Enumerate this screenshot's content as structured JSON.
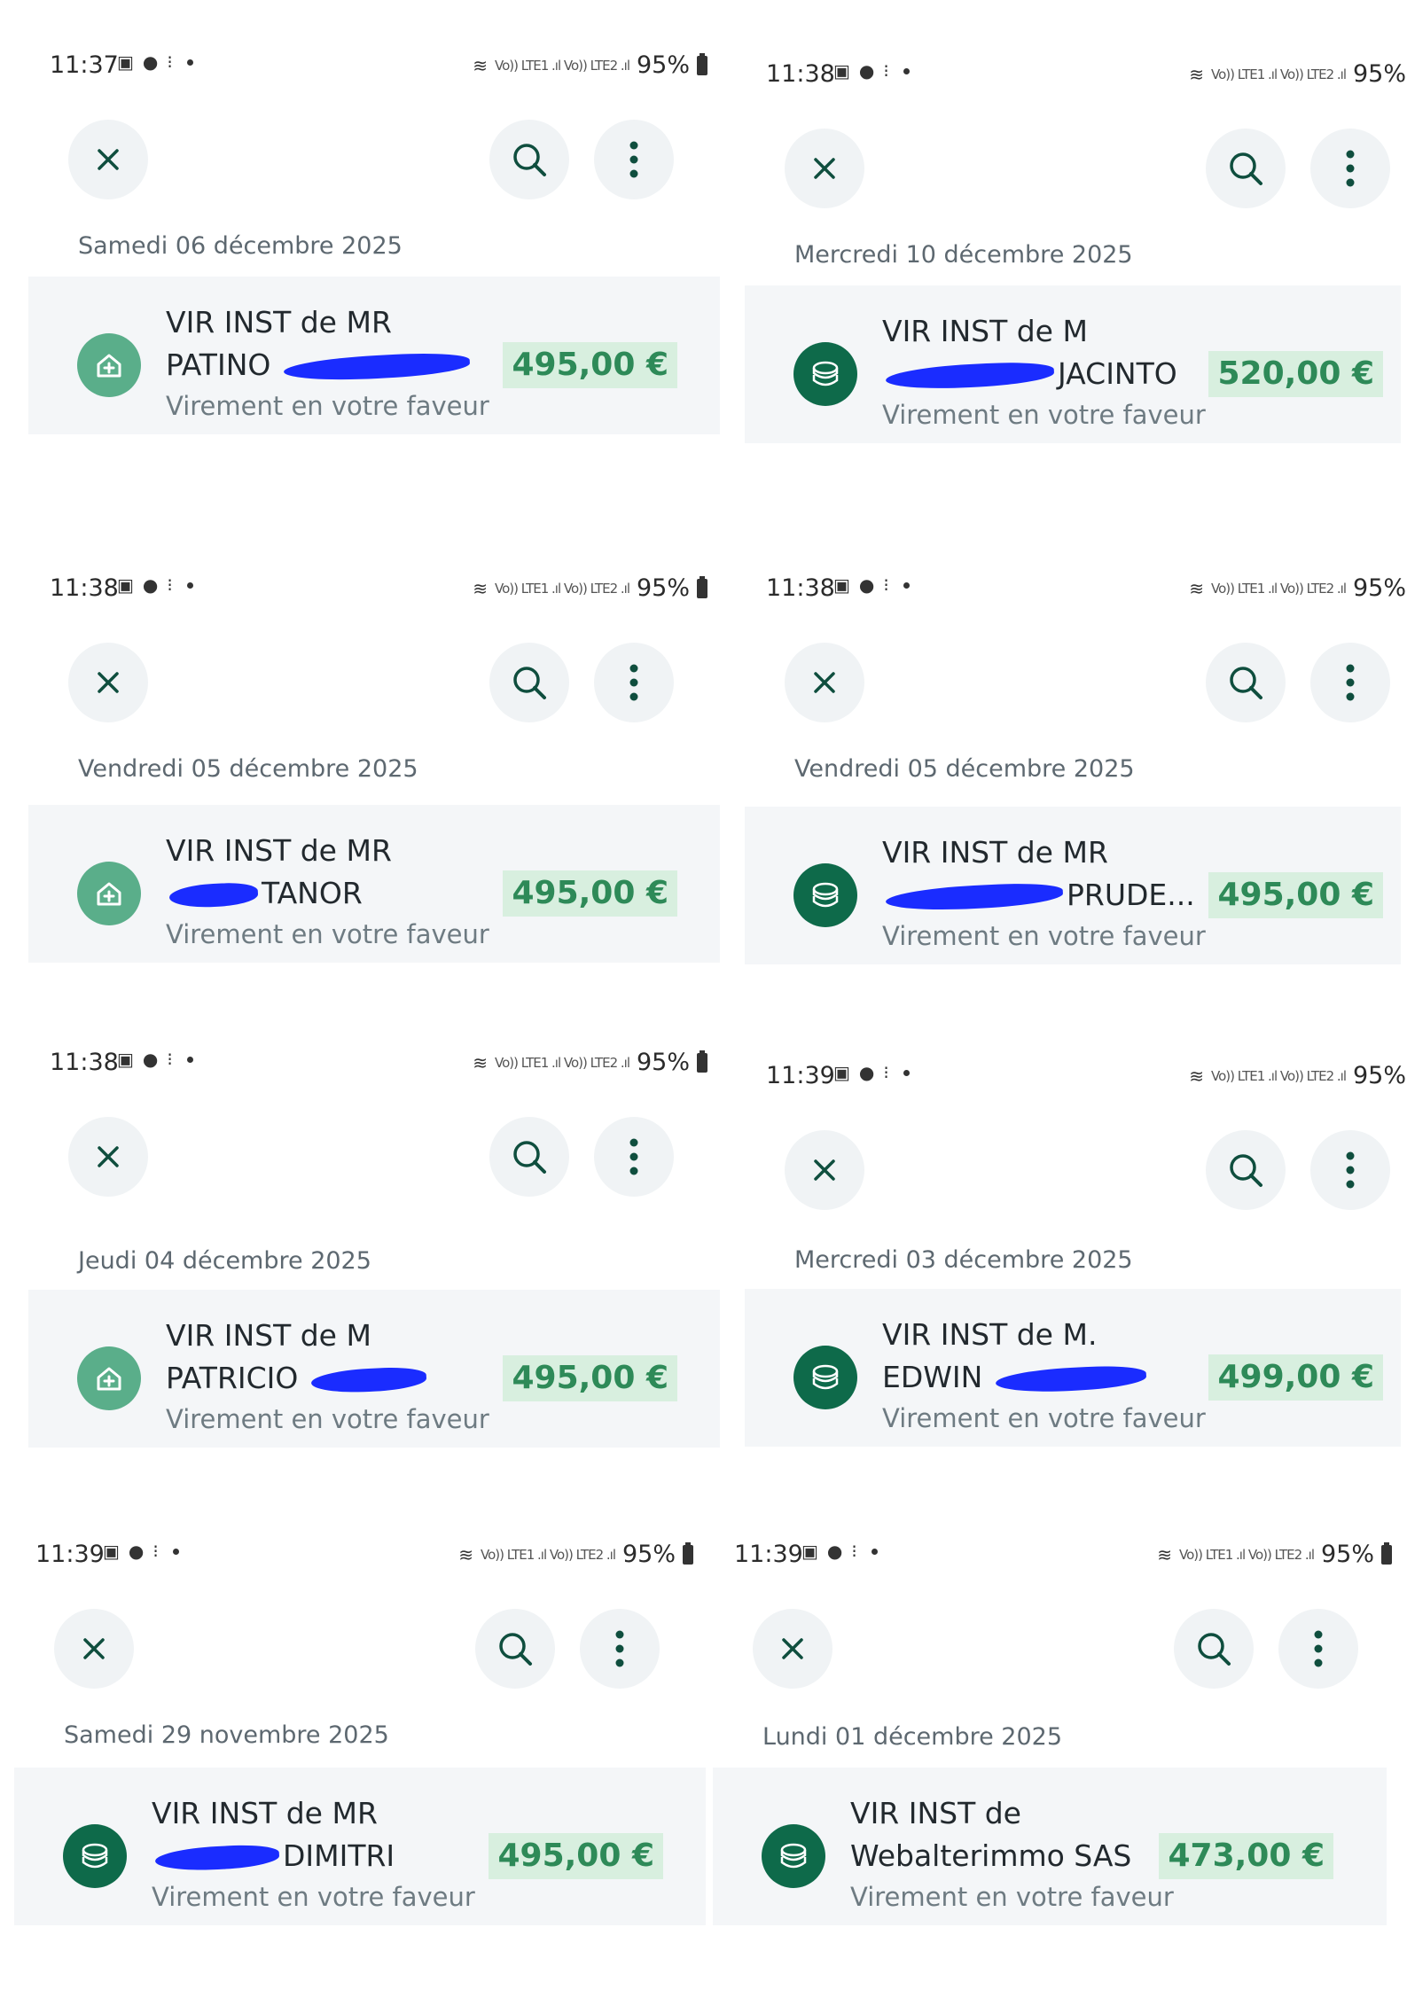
{
  "icons": {
    "status": [
      "gallery-icon",
      "chat-icon",
      "steps-icon",
      "wifi-icon"
    ],
    "close": "close-icon",
    "search": "search-icon",
    "more": "more-vert-icon"
  },
  "colors": {
    "amount_bg": "#d8efdf",
    "amount_text": "#2e8a58",
    "avatar_light": "#5aae8a",
    "avatar_dark": "#0e6a4a",
    "card_bg": "#f4f6f8"
  },
  "panels": [
    {
      "time": "11:37",
      "network": "Vo)) LTE1 .ıl Vo)) LTE2 .ıl",
      "battery": "95%",
      "date": "Samedi 06 décembre 2025",
      "line1": "VIR INST de MR",
      "line2_a": "PATINO ",
      "line2_b": "",
      "line3": "Virement en votre faveur",
      "amount": "495,00 €",
      "avatar": "house-plus-icon"
    },
    {
      "time": "11:38",
      "network": "Vo)) LTE1 .ıl Vo)) LTE2 .ıl",
      "battery": "95%",
      "date": "Mercredi 10 décembre 2025",
      "line1": "VIR INST de M",
      "line2_a": "",
      "line2_b": "JACINTO",
      "line3": "Virement en votre faveur",
      "amount": "520,00 €",
      "avatar": "coins-icon"
    },
    {
      "time": "11:38",
      "network": "Vo)) LTE1 .ıl Vo)) LTE2 .ıl",
      "battery": "95%",
      "date": "Vendredi 05 décembre 2025",
      "line1": "VIR INST de MR",
      "line2_a": "",
      "line2_b": "TANOR",
      "line3": "Virement en votre faveur",
      "amount": "495,00 €",
      "avatar": "house-plus-icon"
    },
    {
      "time": "11:38",
      "network": "Vo)) LTE1 .ıl Vo)) LTE2 .ıl",
      "battery": "95%",
      "date": "Vendredi 05 décembre 2025",
      "line1": "VIR INST de MR",
      "line2_a": "",
      "line2_b": "PRUDE...",
      "line3": "Virement en votre faveur",
      "amount": "495,00 €",
      "avatar": "coins-icon"
    },
    {
      "time": "11:38",
      "network": "Vo)) LTE1 .ıl Vo)) LTE2 .ıl",
      "battery": "95%",
      "date": "Jeudi 04 décembre 2025",
      "line1": "VIR INST de M",
      "line2_a": "PATRICIO ",
      "line2_b": "",
      "line3": "Virement en votre faveur",
      "amount": "495,00 €",
      "avatar": "house-plus-icon"
    },
    {
      "time": "11:39",
      "network": "Vo)) LTE1 .ıl Vo)) LTE2 .ıl",
      "battery": "95%",
      "date": "Mercredi 03 décembre 2025",
      "line1": "VIR INST de M.",
      "line2_a": "EDWIN ",
      "line2_b": "",
      "line3": "Virement en votre faveur",
      "amount": "499,00 €",
      "avatar": "coins-icon"
    },
    {
      "time": "11:39",
      "network": "Vo)) LTE1 .ıl Vo)) LTE2 .ıl",
      "battery": "95%",
      "date": "Samedi 29 novembre 2025",
      "line1": "VIR INST de MR",
      "line2_a": "",
      "line2_b": "DIMITRI",
      "line3": "Virement en votre faveur",
      "amount": "495,00 €",
      "avatar": "coins-icon"
    },
    {
      "time": "11:39",
      "network": "Vo)) LTE1 .ıl Vo)) LTE2 .ıl",
      "battery": "95%",
      "date": "Lundi 01 décembre 2025",
      "line1": "VIR INST de",
      "line2_a": "Webalterimmo SAS",
      "line2_b": "",
      "line3": "Virement en votre faveur",
      "amount": "473,00 €",
      "avatar": "coins-icon"
    }
  ]
}
